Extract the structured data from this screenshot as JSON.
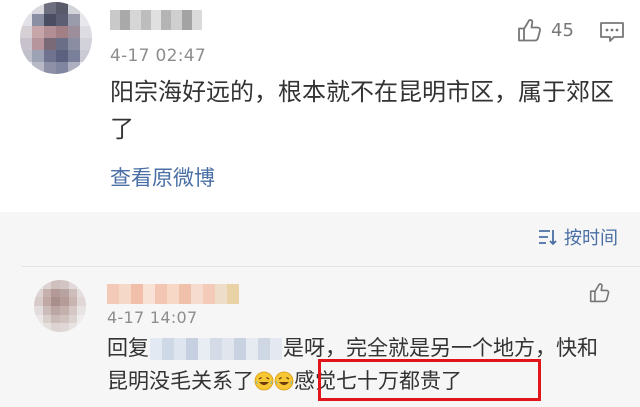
{
  "comment": {
    "time": "4-17 02:47",
    "like_count": "45",
    "text": "阳宗海好远的，根本就不在昆明市区，属于郊区了",
    "view_original": "查看原微博"
  },
  "replies": {
    "sort_label": "按时间",
    "items": [
      {
        "time": "4-17 14:07",
        "reply_prefix": "回复",
        "text_part1": "是呀，完全就是另一个地方，快和昆明没毛关系了",
        "text_part2": "感觉七十万都贵了"
      }
    ]
  },
  "colors": {
    "link": "#4a6fa5",
    "timestamp": "#8d8d8d",
    "highlight_box": "#e0161b",
    "reply_bg": "#f6f6f6"
  },
  "icons": {
    "like": "thumbs-up-icon",
    "reply": "comment-bubble-icon",
    "sort": "sort-lines-icon",
    "emoji": "laughing-tears-emoji"
  }
}
